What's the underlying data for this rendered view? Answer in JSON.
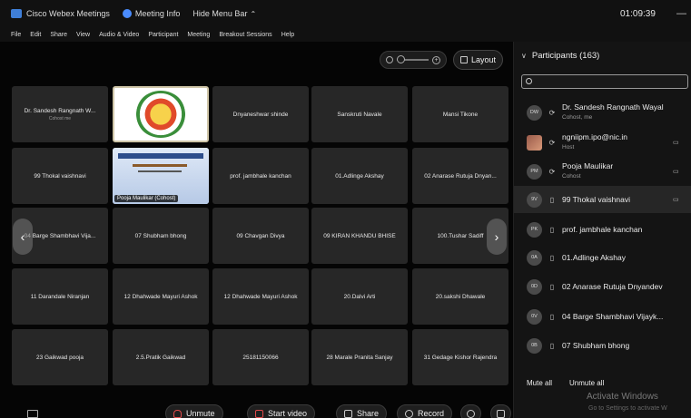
{
  "titlebar": {
    "app_name": "Cisco Webex Meetings",
    "meeting_info": "Meeting Info",
    "hide_menu": "Hide Menu Bar",
    "caret": "⌃",
    "timer": "01:09:39",
    "minimize": "—"
  },
  "menu": [
    "File",
    "Edit",
    "Share",
    "View",
    "Audio & Video",
    "Participant",
    "Meeting",
    "Breakout Sessions",
    "Help"
  ],
  "stage": {
    "layout_label": "Layout",
    "zoom_plus": "+",
    "tiles": [
      {
        "name": "Dr. Sandesh Rangnath W...",
        "sub": "Cohost me"
      },
      {
        "name": "",
        "sub": ""
      },
      {
        "name": "Dnyaneshwar shinde",
        "sub": ""
      },
      {
        "name": "Sanskruti Navale",
        "sub": ""
      },
      {
        "name": "Mansi Tikone",
        "sub": ""
      },
      {
        "name": "99 Thokal vaishnavi",
        "sub": ""
      },
      {
        "name": "Pooja Maulikar (Cohost)",
        "sub": ""
      },
      {
        "name": "prof. jambhale kanchan",
        "sub": ""
      },
      {
        "name": "01.Adlinge Akshay",
        "sub": ""
      },
      {
        "name": "02 Anarase Rutuja Dnyan...",
        "sub": ""
      },
      {
        "name": "04 Barge Shambhavi Vija...",
        "sub": ""
      },
      {
        "name": "07 Shubham bhong",
        "sub": ""
      },
      {
        "name": "09 Chavgan Divya",
        "sub": ""
      },
      {
        "name": "09 KIRAN KHANDU BHISE",
        "sub": ""
      },
      {
        "name": "100.Tushar Sadiff",
        "sub": ""
      },
      {
        "name": "11 Darandale Niranjan",
        "sub": ""
      },
      {
        "name": "12 Dhahwade Mayuri Ashok",
        "sub": ""
      },
      {
        "name": "12 Dhahwade Mayuri Ashok",
        "sub": ""
      },
      {
        "name": "20.Dalvi Arti",
        "sub": ""
      },
      {
        "name": "20.sakshi Dhawale",
        "sub": ""
      },
      {
        "name": "23 Gaikwad pooja",
        "sub": ""
      },
      {
        "name": "2.5.Pratik Gaikwad",
        "sub": ""
      },
      {
        "name": "25181150066",
        "sub": ""
      },
      {
        "name": "28 Marale Pranita Sanjay",
        "sub": ""
      },
      {
        "name": "31 Gedage Kishor Rajendra",
        "sub": ""
      }
    ],
    "prev_arrow": "‹",
    "next_arrow": "›"
  },
  "toolbar": {
    "unmute": "Unmute",
    "start_video": "Start video",
    "share": "Share",
    "record": "Record",
    "end": "×"
  },
  "panel": {
    "title": "Participants (163)",
    "chevron": "∨",
    "participants": [
      {
        "initials": "DW",
        "name": "Dr. Sandesh Rangnath Wayal",
        "role": "Cohost, me",
        "status": "⟳",
        "cam": ""
      },
      {
        "initials": "",
        "name": "ngniipm.ipo@nic.in",
        "role": "Host",
        "status": "⟳",
        "cam": "▭"
      },
      {
        "initials": "PM",
        "name": "Pooja Maulikar",
        "role": "Cohost",
        "status": "⟳",
        "cam": "▭"
      },
      {
        "initials": "9V",
        "name": "99 Thokal vaishnavi",
        "role": "",
        "status": "▯",
        "cam": "▭"
      },
      {
        "initials": "PK",
        "name": "prof. jambhale kanchan",
        "role": "",
        "status": "▯",
        "cam": ""
      },
      {
        "initials": "0A",
        "name": "01.Adlinge Akshay",
        "role": "",
        "status": "▯",
        "cam": ""
      },
      {
        "initials": "0D",
        "name": "02 Anarase Rutuja Dnyandev",
        "role": "",
        "status": "▯",
        "cam": ""
      },
      {
        "initials": "0V",
        "name": "04 Barge Shambhavi Vijayk...",
        "role": "",
        "status": "▯",
        "cam": ""
      },
      {
        "initials": "0B",
        "name": "07 Shubham bhong",
        "role": "",
        "status": "▯",
        "cam": ""
      }
    ],
    "mute_all": "Mute all",
    "unmute_all": "Unmute all"
  },
  "watermark": {
    "line1": "Activate Windows",
    "line2": "Go to Settings to activate W"
  }
}
